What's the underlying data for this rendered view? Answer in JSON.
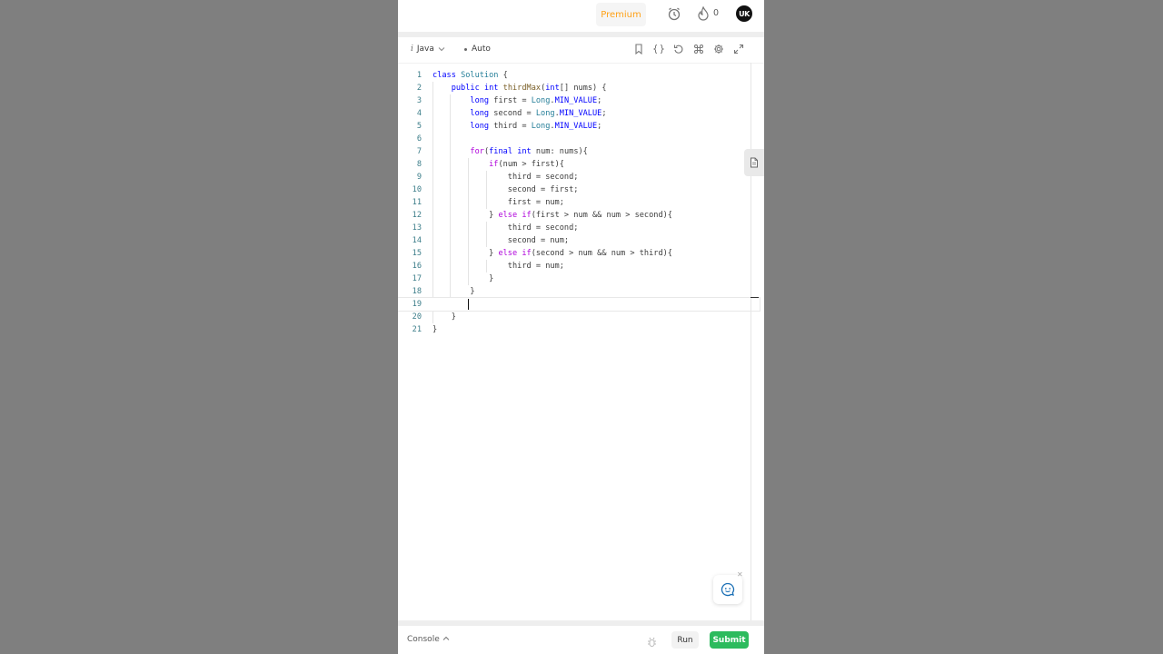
{
  "header": {
    "premium_label": "Premium",
    "streak_count": "0",
    "avatar_initials": "UK"
  },
  "editor": {
    "language": "Java",
    "language_icon": "i",
    "mode": "Auto",
    "tool_icons": [
      "bookmark-icon",
      "braces-icon",
      "reset-icon",
      "shortcut-icon",
      "settings-icon",
      "fullscreen-icon"
    ],
    "current_line": 19,
    "code_lines": [
      "class Solution {",
      "    public int thirdMax(int[] nums) {",
      "        long first = Long.MIN_VALUE;",
      "        long second = Long.MIN_VALUE;",
      "        long third = Long.MIN_VALUE;",
      "",
      "        for(final int num: nums){",
      "            if(num > first){",
      "                third = second;",
      "                second = first;",
      "                first = num;",
      "            } else if(first > num && num > second){",
      "                third = second;",
      "                second = num;",
      "            } else if(second > num && num > third){",
      "                third = num;",
      "            }",
      "        }",
      "        ",
      "    }",
      "}"
    ]
  },
  "footer": {
    "console_label": "Console",
    "run_label": "Run",
    "submit_label": "Submit"
  },
  "colors": {
    "premium": "#ffa116",
    "submit": "#2cbb5d",
    "keyword": "#0000ff",
    "control": "#af00db",
    "type_name": "#267f99",
    "function": "#795e26",
    "line_number": "#3d7e8a"
  }
}
